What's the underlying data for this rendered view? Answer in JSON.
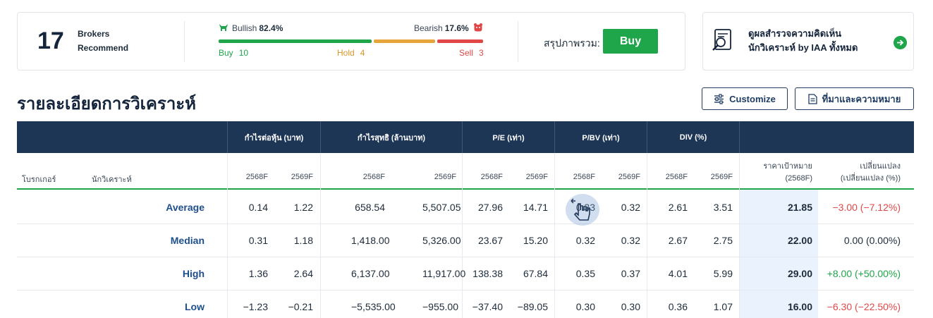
{
  "summary": {
    "count": "17",
    "label_line1": "Brokers",
    "label_line2": "Recommend",
    "bullish_label": "Bullish",
    "bullish_pct": "82.4%",
    "bearish_label": "Bearish",
    "bearish_pct": "17.6%",
    "buy_label": "Buy",
    "buy_count": "10",
    "hold_label": "Hold",
    "hold_count": "4",
    "sell_label": "Sell",
    "sell_count": "3",
    "buy_share": 0.588,
    "hold_share": 0.235,
    "sell_share": 0.176,
    "overall_label": "สรุปภาพรวม:",
    "overall_value": "Buy"
  },
  "survey": {
    "line1": "ดูผลสำรวจความคิดเห็น",
    "line2": "นักวิเคราะห์ by IAA ทั้งหมด"
  },
  "section": {
    "title": "รายละเอียดการวิเคราะห์",
    "customize_label": "Customize",
    "source_label": "ที่มาและความหมาย"
  },
  "table": {
    "groups": [
      "กำไรต่อหุ้น (บาท)",
      "กำไรสุทธิ (ล้านบาท)",
      "P/E (เท่า)",
      "P/BV (เท่า)",
      "DIV (%)"
    ],
    "col_broker": "โบรกเกอร์",
    "col_analyst": "นักวิเคราะห์",
    "years": [
      "2568F",
      "2569F"
    ],
    "target_line1": "ราคาเป้าหมาย",
    "target_line2": "(2568F)",
    "change_line1": "เปลี่ยนแปลง",
    "change_line2": "(เปลี่ยนแปลง (%))",
    "rows": [
      {
        "label": "Average",
        "eps1": "0.14",
        "eps2": "1.22",
        "np1": "658.54",
        "np2": "5,507.05",
        "pe1": "27.96",
        "pe2": "14.71",
        "pbv1": "0.33",
        "pbv2": "0.32",
        "div1": "2.61",
        "div2": "3.51",
        "target": "21.85",
        "change": "−3.00 (−7.12%)",
        "dir": "neg"
      },
      {
        "label": "Median",
        "eps1": "0.31",
        "eps2": "1.18",
        "np1": "1,418.00",
        "np2": "5,326.00",
        "pe1": "23.67",
        "pe2": "15.20",
        "pbv1": "0.32",
        "pbv2": "0.32",
        "div1": "2.67",
        "div2": "2.75",
        "target": "22.00",
        "change": "0.00 (0.00%)",
        "dir": "flat"
      },
      {
        "label": "High",
        "eps1": "1.36",
        "eps2": "2.64",
        "np1": "6,137.00",
        "np2": "11,917.00",
        "pe1": "138.38",
        "pe2": "67.84",
        "pbv1": "0.35",
        "pbv2": "0.37",
        "div1": "4.01",
        "div2": "5.99",
        "target": "29.00",
        "change": "+8.00 (+50.00%)",
        "dir": "pos"
      },
      {
        "label": "Low",
        "eps1": "−1.23",
        "eps2": "−0.21",
        "np1": "−5,535.00",
        "np2": "−955.00",
        "pe1": "−37.40",
        "pe2": "−89.05",
        "pbv1": "0.30",
        "pbv2": "0.30",
        "div1": "0.36",
        "div2": "1.07",
        "target": "16.00",
        "change": "−6.30 (−22.50%)",
        "dir": "neg"
      }
    ]
  },
  "colors": {
    "header_bg": "#1e3656",
    "buy": "#1fa54a",
    "hold": "#e5a53a",
    "sell": "#e04848",
    "link": "#1e4f8c"
  }
}
